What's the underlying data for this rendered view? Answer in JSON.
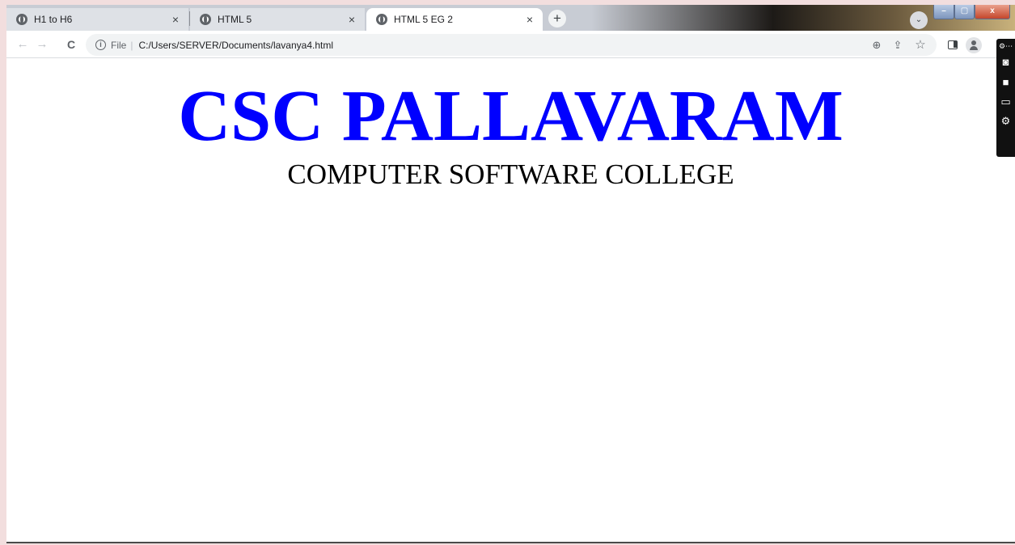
{
  "tabs": [
    {
      "title": "H1 to H6",
      "close": "×",
      "active": false
    },
    {
      "title": "HTML 5",
      "close": "×",
      "active": false
    },
    {
      "title": "HTML 5 EG 2",
      "close": "×",
      "active": true
    }
  ],
  "new_tab_symbol": "+",
  "tab_search_symbol": "⌄",
  "window_controls": {
    "minimize": "–",
    "maximize": "▢",
    "close": "x"
  },
  "toolbar": {
    "back": "←",
    "forward": "→",
    "reload": "C",
    "info_symbol": "i",
    "scheme": "File",
    "divider": "|",
    "url": "C:/Users/SERVER/Documents/lavanya4.html",
    "zoom_symbol": "⊕",
    "share_symbol": "⇪",
    "bookmark_symbol": "☆"
  },
  "page": {
    "heading": "CSC PALLAVARAM",
    "subheading": "COMPUTER SOFTWARE COLLEGE"
  },
  "capture_bar": {
    "dots": "⚙⋯",
    "camera": "◙",
    "video": "■",
    "window": "▭",
    "settings": "⚙"
  },
  "colors": {
    "heading": "#0000ff",
    "subheading": "#000000",
    "tab_strip": "#dee1e6",
    "page_background": "#ffffff"
  }
}
